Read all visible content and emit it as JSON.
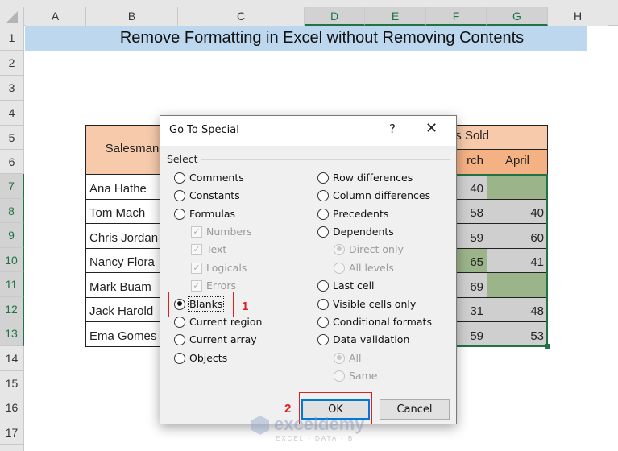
{
  "columns": [
    {
      "label": "A",
      "selected": false
    },
    {
      "label": "B",
      "selected": false
    },
    {
      "label": "C",
      "selected": false
    },
    {
      "label": "D",
      "selected": true
    },
    {
      "label": "E",
      "selected": true
    },
    {
      "label": "F",
      "selected": true
    },
    {
      "label": "G",
      "selected": true
    },
    {
      "label": "H",
      "selected": false
    }
  ],
  "rows": [
    "1",
    "2",
    "3",
    "4",
    "5",
    "6",
    "7",
    "8",
    "9",
    "10",
    "11",
    "12",
    "13",
    "14",
    "15",
    "16",
    "17"
  ],
  "selected_rows": [
    "7",
    "8",
    "9",
    "10",
    "11",
    "12",
    "13"
  ],
  "title": "Remove Formatting in Excel without Removing Contents",
  "table": {
    "header_salesman": "Salesman",
    "header_units_sold_partial": "s Sold",
    "header_march_partial": "rch",
    "header_april": "April",
    "rows": [
      {
        "name": "Ana Hathe",
        "march": "40",
        "april": "",
        "march_blank_hl": false,
        "april_blank_hl": true
      },
      {
        "name": "Tom Mach",
        "march": "58",
        "april": "40",
        "march_blank_hl": false,
        "april_blank_hl": false
      },
      {
        "name": "Chris Jordan",
        "march": "59",
        "april": "60",
        "march_blank_hl": false,
        "april_blank_hl": false
      },
      {
        "name": "Nancy Flora",
        "march": "65",
        "april": "41",
        "march_blank_hl": true,
        "april_blank_hl": false
      },
      {
        "name": "Mark Buam",
        "march": "69",
        "april": "",
        "march_blank_hl": false,
        "april_blank_hl": true
      },
      {
        "name": "Jack Harold",
        "march": "31",
        "april": "48",
        "march_blank_hl": false,
        "april_blank_hl": false
      },
      {
        "name": "Ema Gomes",
        "march": "59",
        "april": "53",
        "march_blank_hl": false,
        "april_blank_hl": false
      }
    ]
  },
  "dialog": {
    "title": "Go To Special",
    "help_label": "?",
    "close_label": "✕",
    "group_label": "Select",
    "left_options": [
      {
        "label": "Comments",
        "checked": false
      },
      {
        "label": "Constants",
        "checked": false
      },
      {
        "label": "Formulas",
        "checked": false
      },
      {
        "label": "Numbers",
        "type": "checkbox",
        "checked": true,
        "disabled": true
      },
      {
        "label": "Text",
        "type": "checkbox",
        "checked": true,
        "disabled": true
      },
      {
        "label": "Logicals",
        "type": "checkbox",
        "checked": true,
        "disabled": true
      },
      {
        "label": "Errors",
        "type": "checkbox",
        "checked": true,
        "disabled": true
      },
      {
        "label": "Blanks",
        "checked": true
      },
      {
        "label": "Current region",
        "checked": false
      },
      {
        "label": "Current array",
        "checked": false
      },
      {
        "label": "Objects",
        "checked": false
      }
    ],
    "right_options": [
      {
        "label": "Row differences",
        "checked": false
      },
      {
        "label": "Column differences",
        "checked": false
      },
      {
        "label": "Precedents",
        "checked": false
      },
      {
        "label": "Dependents",
        "checked": false
      },
      {
        "label": "Direct only",
        "checked": true,
        "disabled": true
      },
      {
        "label": "All levels",
        "checked": false,
        "disabled": true
      },
      {
        "label": "Last cell",
        "checked": false
      },
      {
        "label": "Visible cells only",
        "checked": false
      },
      {
        "label": "Conditional formats",
        "checked": false
      },
      {
        "label": "Data validation",
        "checked": false
      },
      {
        "label": "All",
        "checked": true,
        "disabled": true
      },
      {
        "label": "Same",
        "checked": false,
        "disabled": true
      }
    ],
    "ok_label": "OK",
    "cancel_label": "Cancel"
  },
  "annotations": {
    "step1": "1",
    "step2": "2"
  },
  "watermark": {
    "brand": "exceldemy",
    "tagline": "EXCEL - DATA - BI"
  },
  "colors": {
    "selection": "#217346",
    "title_fill": "#bdd7ee",
    "header_fill": "#f7caac",
    "blank_highlight": "#9bb48a",
    "annotation": "#e02020"
  }
}
